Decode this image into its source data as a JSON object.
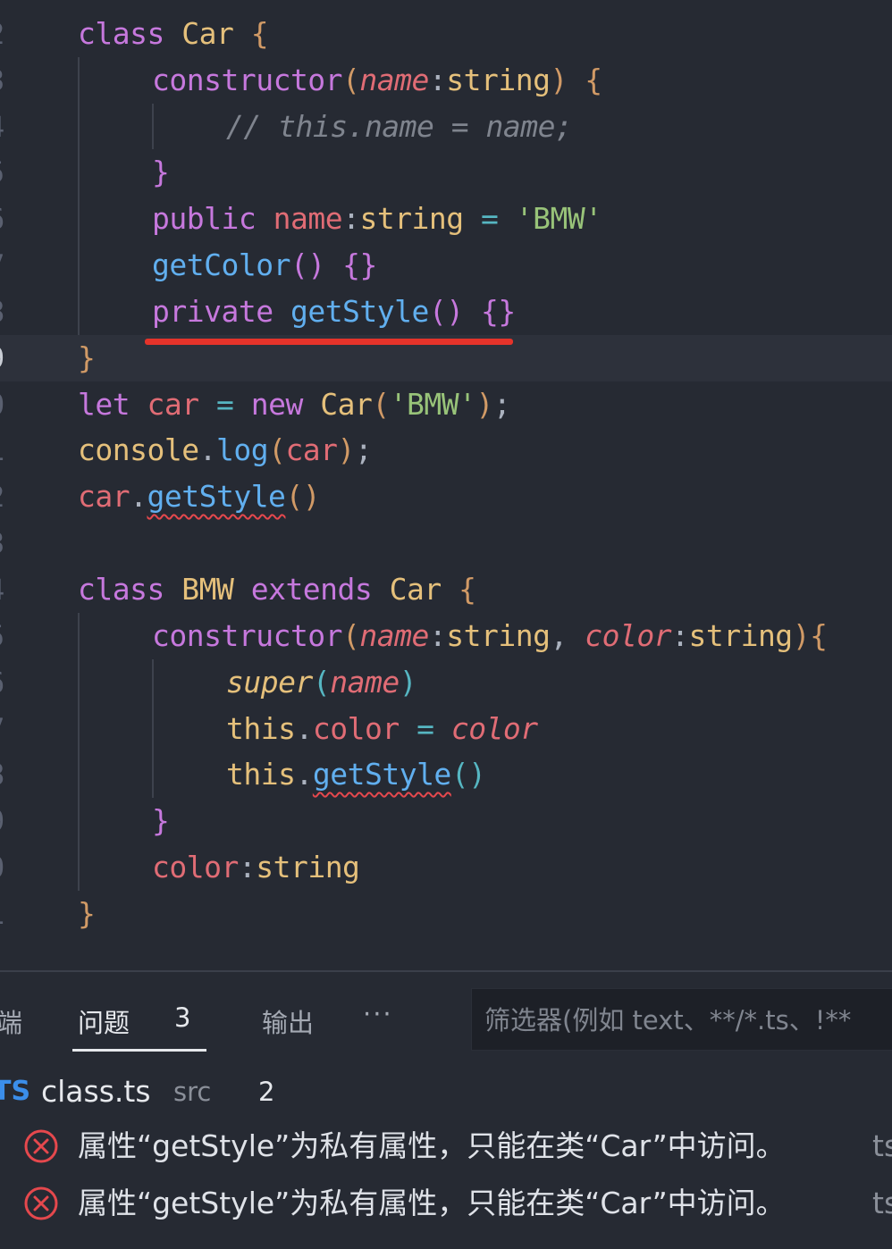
{
  "editor": {
    "line_numbers": [
      "2",
      "3",
      "4",
      "5",
      "6",
      "7",
      "8",
      "9",
      "0",
      "1",
      "2",
      "3",
      "4",
      "5",
      "6",
      "7",
      "8",
      "9",
      "0",
      "1"
    ],
    "annotation": "red-underline",
    "lines": [
      {
        "tokens": [
          {
            "t": "class",
            "c": "kw"
          },
          {
            "t": " "
          },
          {
            "t": "Car",
            "c": "type"
          },
          {
            "t": " "
          },
          {
            "t": "{",
            "c": "brace"
          }
        ]
      },
      {
        "tokens": [
          {
            "t": "constructor",
            "c": "kw"
          },
          {
            "t": "(",
            "c": "brace"
          },
          {
            "t": "name",
            "c": "param"
          },
          {
            "t": ":",
            "c": "plain"
          },
          {
            "t": "string",
            "c": "type"
          },
          {
            "t": ")",
            "c": "brace"
          },
          {
            "t": " "
          },
          {
            "t": "{",
            "c": "brace"
          }
        ]
      },
      {
        "tokens": [
          {
            "t": "// this.name = name;",
            "c": "comment"
          }
        ]
      },
      {
        "tokens": [
          {
            "t": "}",
            "c": "purple"
          }
        ]
      },
      {
        "tokens": [
          {
            "t": "public",
            "c": "kw"
          },
          {
            "t": " "
          },
          {
            "t": "name",
            "c": "prop"
          },
          {
            "t": ":",
            "c": "plain"
          },
          {
            "t": "string",
            "c": "type"
          },
          {
            "t": " "
          },
          {
            "t": "=",
            "c": "op"
          },
          {
            "t": " "
          },
          {
            "t": "'BMW'",
            "c": "str"
          }
        ]
      },
      {
        "tokens": [
          {
            "t": "getColor",
            "c": "fn"
          },
          {
            "t": "()",
            "c": "purple"
          },
          {
            "t": " "
          },
          {
            "t": "{}",
            "c": "purple"
          }
        ]
      },
      {
        "tokens": [
          {
            "t": "private",
            "c": "kw"
          },
          {
            "t": " "
          },
          {
            "t": "getStyle",
            "c": "fn"
          },
          {
            "t": "()",
            "c": "purple"
          },
          {
            "t": " "
          },
          {
            "t": "{}",
            "c": "purple"
          }
        ]
      },
      {
        "tokens": [
          {
            "t": "}",
            "c": "brace"
          }
        ]
      },
      {
        "tokens": [
          {
            "t": "let",
            "c": "kw"
          },
          {
            "t": " "
          },
          {
            "t": "car",
            "c": "prop"
          },
          {
            "t": " "
          },
          {
            "t": "=",
            "c": "op"
          },
          {
            "t": " "
          },
          {
            "t": "new",
            "c": "kw"
          },
          {
            "t": " "
          },
          {
            "t": "Car",
            "c": "type"
          },
          {
            "t": "(",
            "c": "brace"
          },
          {
            "t": "'BMW'",
            "c": "str"
          },
          {
            "t": ")",
            "c": "brace"
          },
          {
            "t": ";",
            "c": "plain"
          }
        ]
      },
      {
        "tokens": [
          {
            "t": "console",
            "c": "type"
          },
          {
            "t": ".",
            "c": "plain"
          },
          {
            "t": "log",
            "c": "fn"
          },
          {
            "t": "(",
            "c": "brace"
          },
          {
            "t": "car",
            "c": "prop"
          },
          {
            "t": ")",
            "c": "brace"
          },
          {
            "t": ";",
            "c": "plain"
          }
        ]
      },
      {
        "tokens": [
          {
            "t": "car",
            "c": "prop"
          },
          {
            "t": ".",
            "c": "plain"
          },
          {
            "t": "getStyle",
            "c": "fn",
            "sq": true
          },
          {
            "t": "()",
            "c": "brace"
          }
        ]
      },
      {
        "tokens": []
      },
      {
        "tokens": [
          {
            "t": "class",
            "c": "kw"
          },
          {
            "t": " "
          },
          {
            "t": "BMW",
            "c": "type"
          },
          {
            "t": " "
          },
          {
            "t": "extends",
            "c": "kw"
          },
          {
            "t": " "
          },
          {
            "t": "Car",
            "c": "type"
          },
          {
            "t": " "
          },
          {
            "t": "{",
            "c": "brace"
          }
        ]
      },
      {
        "tokens": [
          {
            "t": "constructor",
            "c": "kw"
          },
          {
            "t": "(",
            "c": "brace"
          },
          {
            "t": "name",
            "c": "param"
          },
          {
            "t": ":",
            "c": "plain"
          },
          {
            "t": "string",
            "c": "type"
          },
          {
            "t": ", ",
            "c": "plain"
          },
          {
            "t": "color",
            "c": "param"
          },
          {
            "t": ":",
            "c": "plain"
          },
          {
            "t": "string",
            "c": "type"
          },
          {
            "t": ")",
            "c": "brace"
          },
          {
            "t": "{",
            "c": "brace"
          }
        ]
      },
      {
        "tokens": [
          {
            "t": "super",
            "c": "super"
          },
          {
            "t": "(",
            "c": "cyan"
          },
          {
            "t": "name",
            "c": "param"
          },
          {
            "t": ")",
            "c": "cyan"
          }
        ]
      },
      {
        "tokens": [
          {
            "t": "this",
            "c": "type"
          },
          {
            "t": ".",
            "c": "plain"
          },
          {
            "t": "color",
            "c": "prop"
          },
          {
            "t": " "
          },
          {
            "t": "=",
            "c": "op"
          },
          {
            "t": " "
          },
          {
            "t": "color",
            "c": "param"
          }
        ]
      },
      {
        "tokens": [
          {
            "t": "this",
            "c": "type"
          },
          {
            "t": ".",
            "c": "plain"
          },
          {
            "t": "getStyle",
            "c": "fn",
            "sq": true
          },
          {
            "t": "()",
            "c": "cyan"
          }
        ]
      },
      {
        "tokens": [
          {
            "t": "}",
            "c": "purple"
          }
        ]
      },
      {
        "tokens": [
          {
            "t": "color",
            "c": "prop"
          },
          {
            "t": ":",
            "c": "plain"
          },
          {
            "t": "string",
            "c": "type"
          }
        ]
      },
      {
        "tokens": [
          {
            "t": "}",
            "c": "brace"
          }
        ]
      }
    ]
  },
  "colors": {
    "kw": "#c678dd",
    "type": "#e5c07b",
    "brace": "#d19a66",
    "param": "#e06c75",
    "comment": "#7f848e",
    "prop": "#e06c75",
    "str": "#98c379",
    "fn": "#61afef",
    "purple": "#c678dd",
    "op": "#56b6c2",
    "super": "#e5c07b",
    "cyan": "#56b6c2",
    "plain": "#abb2bf"
  },
  "panel": {
    "tabs": {
      "left_fragment": "端",
      "problems": "问题",
      "problems_count": "3",
      "output": "输出",
      "more": "···"
    },
    "filter_placeholder": "筛选器(例如 text、**/*.ts、!**",
    "file_icon": "TS",
    "file_name": "class.ts",
    "file_dir": "src",
    "file_count": "2",
    "errors": [
      {
        "icon": "error-circle-icon",
        "message": "属性“getStyle”为私有属性，只能在类“Car”中访问。",
        "source": "ts"
      },
      {
        "icon": "error-circle-icon",
        "message": "属性“getStyle”为私有属性，只能在类“Car”中访问。",
        "source": "ts"
      }
    ]
  }
}
